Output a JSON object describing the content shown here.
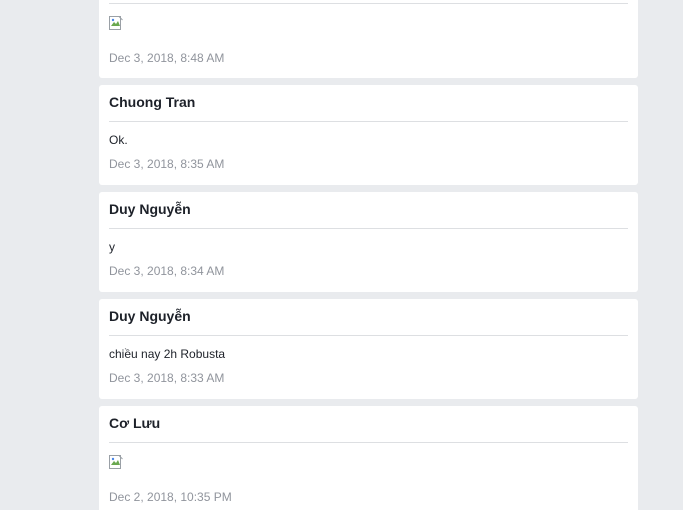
{
  "posts": [
    {
      "author": "",
      "image": "broken-image-icon",
      "timestamp": "Dec 3, 2018, 8:48 AM"
    },
    {
      "author": "Chuong Tran",
      "text": "Ok.",
      "timestamp": "Dec 3, 2018, 8:35 AM"
    },
    {
      "author": "Duy Nguyễn",
      "text": "y",
      "timestamp": "Dec 3, 2018, 8:34 AM"
    },
    {
      "author": "Duy Nguyễn",
      "text": "chiều nay 2h Robusta",
      "timestamp": "Dec 3, 2018, 8:33 AM"
    },
    {
      "author": "Cơ Lưu",
      "image": "broken-image-icon",
      "timestamp": "Dec 2, 2018, 10:35 PM"
    }
  ]
}
